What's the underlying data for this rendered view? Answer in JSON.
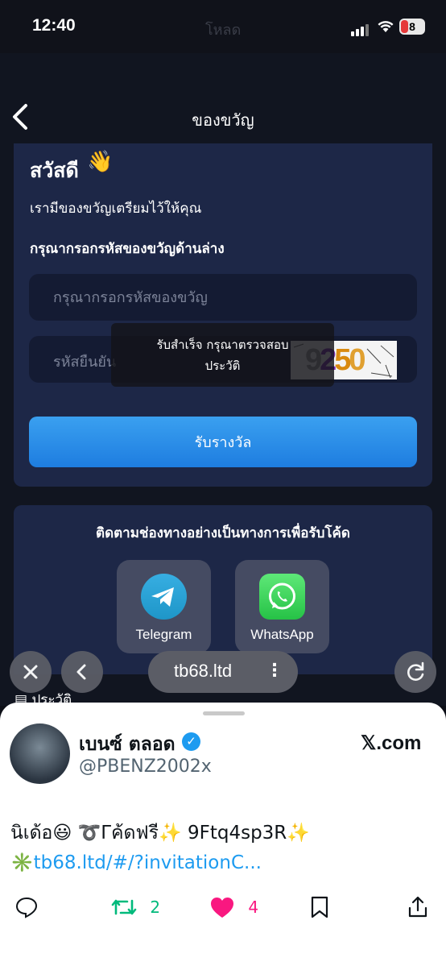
{
  "status_bar": {
    "time": "12:40",
    "battery": "8",
    "ghost_title": "โหลด"
  },
  "header": {
    "title": "ของขวัญ"
  },
  "gift_card": {
    "greeting": "สวัสดี",
    "greeting_emoji": "👋",
    "line1": "เรามีของขวัญเตรียมไว้ให้คุณ",
    "line2": "กรุณากรอกรหัสของขวัญด้านล่าง",
    "code_placeholder": "กรุณากรอกรหัสของขวัญ",
    "verify_placeholder": "รหัสยืนยัน",
    "captcha_code": "9250",
    "toast_line1": "รับสำเร็จ กรุณาตรวจสอบ",
    "toast_line2": "ประวัติ",
    "claim_button": "รับรางวัล"
  },
  "follow_card": {
    "title": "ติดตามช่องทางอย่างเป็นทางการเพื่อรับโค้ด",
    "channels": [
      {
        "label": "Telegram",
        "icon": "telegram-icon"
      },
      {
        "label": "WhatsApp",
        "icon": "whatsapp-icon"
      }
    ]
  },
  "browser_bar": {
    "url": "tb68.ltd",
    "history_peek": "ประวัติ"
  },
  "tweet_sheet": {
    "display_name": "เบนซ์ ตลอด",
    "handle": "@PBENZ2002x",
    "site": "𝕏.com",
    "text_part1": "นิเด้อ😃 ➰Γค้ดฟรี✨ 9Ftq4sp3R✨",
    "text_emoji": "✳️",
    "text_link": "tb68.ltd/#/?invitationC...",
    "retweets": "2",
    "likes": "4"
  },
  "colors": {
    "accent": "#1d9bf0",
    "button": "#2a8de8",
    "like": "#f91880",
    "retweet": "#00ba7c"
  }
}
